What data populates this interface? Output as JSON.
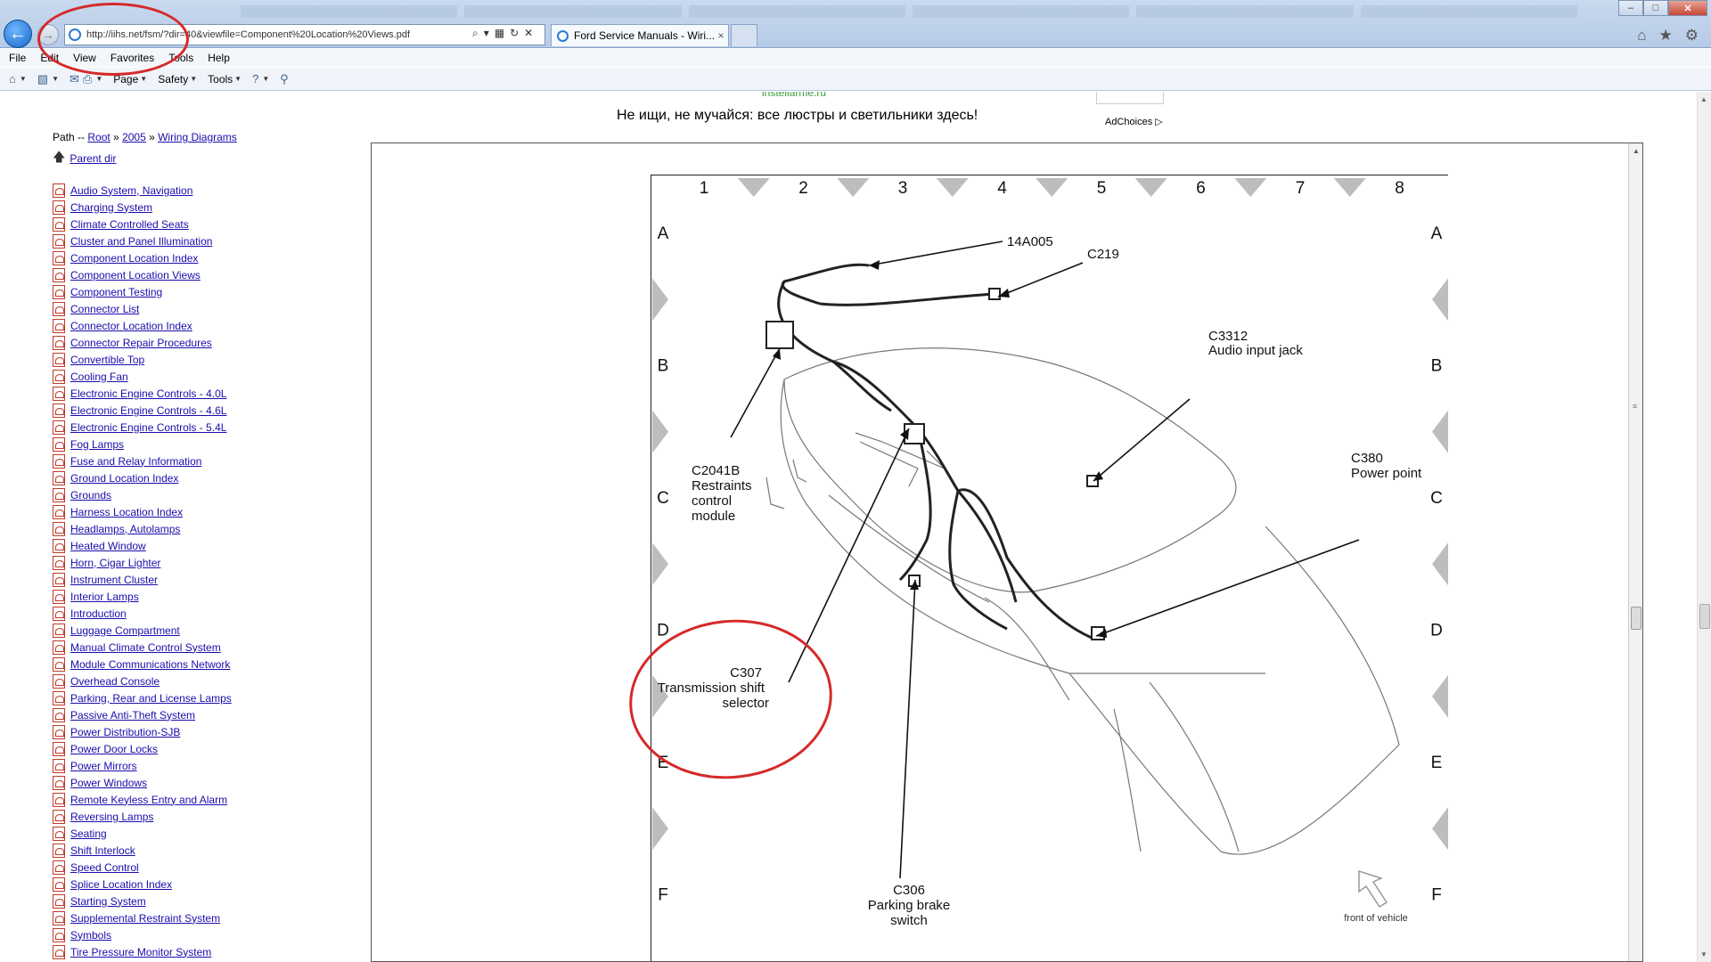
{
  "browser": {
    "url": "http://iihs.net/fsm/?dir=40&viewfile=Component%20Location%20Views.pdf",
    "tab_title": "Ford Service Manuals - Wiri...",
    "tab_close": "×",
    "menu": [
      "File",
      "Edit",
      "View",
      "Favorites",
      "Tools",
      "Help"
    ],
    "command": {
      "page": "Page",
      "safety": "Safety",
      "tools": "Tools"
    }
  },
  "ad": {
    "remnant": "lnstellarme.ru",
    "text": "Не ищи, не мучайся: все люстры и светильники здесь!",
    "choices": "AdChoices ▷"
  },
  "path": {
    "prefix": "Path -- ",
    "separator": " » ",
    "items": [
      "Root",
      "2005",
      "Wiring Diagrams"
    ]
  },
  "parent_dir": "Parent dir",
  "nav_items": [
    "Audio System, Navigation",
    "Charging System",
    "Climate Controlled Seats",
    "Cluster and Panel Illumination",
    "Component Location Index",
    "Component Location Views",
    "Component Testing",
    "Connector List",
    "Connector Location Index",
    "Connector Repair Procedures",
    "Convertible Top",
    "Cooling Fan",
    "Electronic Engine Controls - 4.0L",
    "Electronic Engine Controls - 4.6L",
    "Electronic Engine Controls - 5.4L",
    "Fog Lamps",
    "Fuse and Relay Information",
    "Ground Location Index",
    "Grounds",
    "Harness Location Index",
    "Headlamps, Autolamps",
    "Heated Window",
    "Horn, Cigar Lighter",
    "Instrument Cluster",
    "Interior Lamps",
    "Introduction",
    "Luggage Compartment",
    "Manual Climate Control System",
    "Module Communications Network",
    "Overhead Console",
    "Parking, Rear and License Lamps",
    "Passive Anti-Theft System",
    "Power Distribution-SJB",
    "Power Door Locks",
    "Power Mirrors",
    "Power Windows",
    "Remote Keyless Entry and Alarm",
    "Reversing Lamps",
    "Seating",
    "Shift Interlock",
    "Speed Control",
    "Splice Location Index",
    "Starting System",
    "Supplemental Restraint System",
    "Symbols",
    "Tire Pressure Monitor System"
  ],
  "diagram": {
    "columns": [
      "1",
      "2",
      "3",
      "4",
      "5",
      "6",
      "7",
      "8"
    ],
    "rows": [
      "A",
      "B",
      "C",
      "D",
      "E",
      "F"
    ],
    "callouts": {
      "c14a005": "14A005",
      "c219": "C219",
      "c3312": "C3312",
      "c3312_desc": "Audio input jack",
      "c2041b": "C2041B",
      "c2041b_l2": "Restraints",
      "c2041b_l3": "control",
      "c2041b_l4": "module",
      "c380": "C380",
      "c380_desc": "Power point",
      "c307": "C307",
      "c307_l2": "Transmission shift",
      "c307_l3": "selector",
      "c306": "C306",
      "c306_l2": "Parking brake",
      "c306_l3": "switch"
    },
    "front_label": "front of vehicle"
  },
  "colors": {
    "annotation_red": "#d42a2a",
    "link": "#1a0dab",
    "ie_blue": "#1769c9"
  }
}
